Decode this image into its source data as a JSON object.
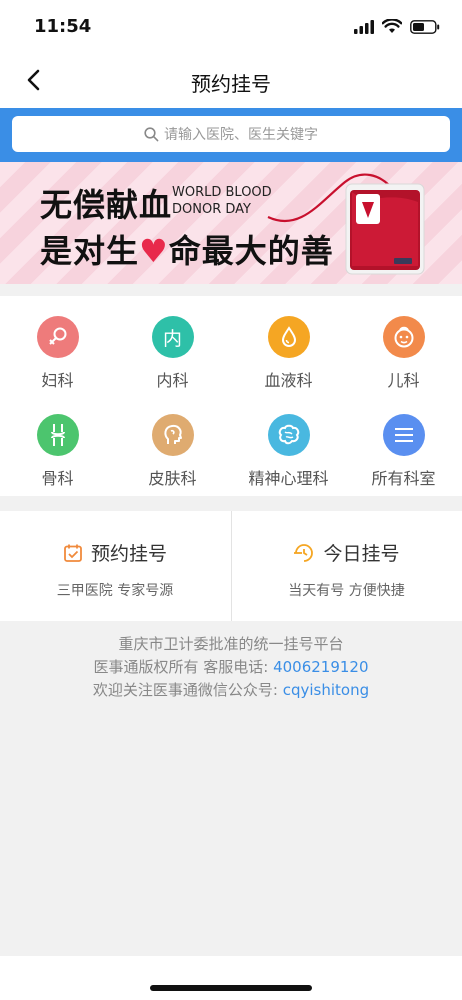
{
  "status": {
    "time": "11:54"
  },
  "nav": {
    "title": "预约挂号"
  },
  "search": {
    "placeholder": "请输入医院、医生关键字"
  },
  "banner": {
    "line1": "无偿献血",
    "line2_a": "是对生",
    "line2_b": "命最大的善",
    "en_line1": "WORLD BLOOD",
    "en_line2": "DONOR DAY"
  },
  "categories": [
    {
      "label": "妇科",
      "icon": "female-symbol-icon",
      "color": "#ee7b7b"
    },
    {
      "label": "内科",
      "icon": "internal-medicine-icon",
      "glyph": "内",
      "color": "#2ec0a8"
    },
    {
      "label": "血液科",
      "icon": "blood-drop-icon",
      "color": "#f5a623"
    },
    {
      "label": "儿科",
      "icon": "baby-face-icon",
      "color": "#f28a4b"
    },
    {
      "label": "骨科",
      "icon": "bone-joint-icon",
      "color": "#4cc56e"
    },
    {
      "label": "皮肤科",
      "icon": "head-profile-icon",
      "color": "#dfab70"
    },
    {
      "label": "精神心理科",
      "icon": "brain-icon",
      "color": "#49b8e0"
    },
    {
      "label": "所有科室",
      "icon": "list-menu-icon",
      "color": "#5a8ff0"
    }
  ],
  "cards": [
    {
      "title": "预约挂号",
      "sub": "三甲医院 专家号源",
      "icon": "calendar-check-icon",
      "color": "#f08a3c"
    },
    {
      "title": "今日挂号",
      "sub": "当天有号 方便快捷",
      "icon": "clock-icon",
      "color": "#f5a623"
    }
  ],
  "footer": {
    "line1": "重庆市卫计委批准的统一挂号平台",
    "line2_prefix": "医事通版权所有 客服电话:",
    "phone": "4006219120",
    "line3_prefix": "欢迎关注医事通微信公众号:",
    "wechat": "cqyishitong"
  },
  "colors": {
    "brand_blue": "#3a8ee6",
    "page_bg": "#f1f1f1"
  }
}
